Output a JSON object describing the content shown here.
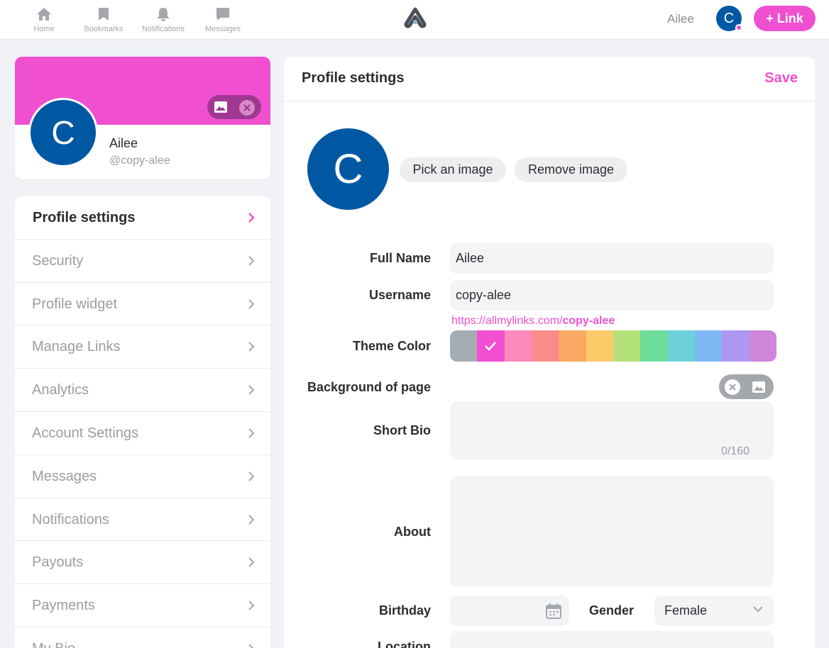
{
  "nav": {
    "items": [
      {
        "label": "Home",
        "icon": "home-icon"
      },
      {
        "label": "Bookmarks",
        "icon": "bookmark-icon"
      },
      {
        "label": "Notifications",
        "icon": "bell-icon"
      },
      {
        "label": "Messages",
        "icon": "message-icon"
      }
    ],
    "user_name": "Ailee",
    "avatar_letter": "C",
    "link_button": "+ Link"
  },
  "profile_card": {
    "avatar_letter": "C",
    "name": "Ailee",
    "handle": "@copy-alee",
    "cover_color": "#f050d0"
  },
  "sidebar": {
    "items": [
      {
        "label": "Profile settings",
        "active": true
      },
      {
        "label": "Security"
      },
      {
        "label": "Profile widget"
      },
      {
        "label": "Manage Links"
      },
      {
        "label": "Analytics"
      },
      {
        "label": "Account Settings"
      },
      {
        "label": "Messages"
      },
      {
        "label": "Notifications"
      },
      {
        "label": "Payouts"
      },
      {
        "label": "Payments"
      },
      {
        "label": "My Bio"
      }
    ]
  },
  "main": {
    "title": "Profile settings",
    "save": "Save",
    "avatar_letter": "C",
    "pick_image": "Pick an image",
    "remove_image": "Remove image",
    "labels": {
      "full_name": "Full Name",
      "username": "Username",
      "theme_color": "Theme Color",
      "background": "Background of page",
      "short_bio": "Short Bio",
      "about": "About",
      "birthday": "Birthday",
      "gender": "Gender",
      "location": "Location"
    },
    "values": {
      "full_name": "Ailee",
      "username": "copy-alee",
      "url_prefix": "https://allmylinks.com/",
      "url_user": "copy-alee",
      "bio_counter": "0/160",
      "gender": "Female"
    },
    "theme_colors": [
      "#a4adb3",
      "#f050d0",
      "#fb8bbd",
      "#fb8a8a",
      "#fba864",
      "#fbcb6a",
      "#b4e07a",
      "#6ddc9a",
      "#6dd0db",
      "#7db9f5",
      "#ad97f3",
      "#cd86da"
    ],
    "selected_color_index": 1
  }
}
